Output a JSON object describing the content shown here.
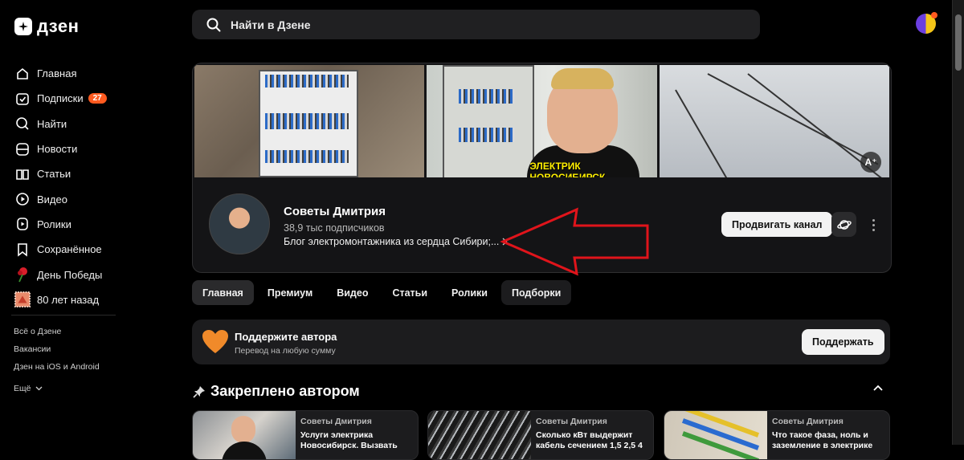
{
  "logo": {
    "text": "дзен"
  },
  "search": {
    "placeholder": "Найти в Дзене"
  },
  "sidebar": {
    "items": [
      {
        "label": "Главная",
        "icon": "home-icon"
      },
      {
        "label": "Подписки",
        "icon": "subscriptions-icon",
        "badge": "27"
      },
      {
        "label": "Найти",
        "icon": "search-icon"
      },
      {
        "label": "Новости",
        "icon": "news-icon"
      },
      {
        "label": "Статьи",
        "icon": "articles-icon"
      },
      {
        "label": "Видео",
        "icon": "video-icon"
      },
      {
        "label": "Ролики",
        "icon": "shorts-icon"
      },
      {
        "label": "Сохранённое",
        "icon": "bookmark-icon"
      },
      {
        "label": "День Победы",
        "icon": "carnation-icon"
      },
      {
        "label": "80 лет назад",
        "icon": "stamp-icon"
      }
    ],
    "links": [
      "Всё о Дзене",
      "Вакансии",
      "Дзен на iOS и Android",
      "Ещё"
    ]
  },
  "banner": {
    "caption": "ЭЛЕКТРИК НОВОСИБИРСК",
    "font_button": "A⁺"
  },
  "channel": {
    "name": "Советы Дмитрия",
    "subscribers": "38,9 тыс подписчиков",
    "description": "Блог электромонтажника из сердца Сибири;...",
    "promote_label": "Продвигать канал"
  },
  "tabs": [
    "Главная",
    "Премиум",
    "Видео",
    "Статьи",
    "Ролики",
    "Подборки"
  ],
  "support": {
    "title": "Поддержите автора",
    "subtitle": "Перевод на любую сумму",
    "button": "Поддержать"
  },
  "pinned": {
    "title": "Закреплено автором",
    "cards": [
      {
        "author": "Советы Дмитрия",
        "title": "Услуги электрика Новосибирск. Вызвать"
      },
      {
        "author": "Советы Дмитрия",
        "title": "Сколько кВт выдержит кабель сечением 1,5 2,5 4"
      },
      {
        "author": "Советы Дмитрия",
        "title": "Что такое фаза, ноль и заземление в электрике"
      }
    ]
  },
  "colors": {
    "accent": "#ff5a1f",
    "background": "#000000",
    "card": "#1c1c1e",
    "arrow": "#e0141b"
  }
}
